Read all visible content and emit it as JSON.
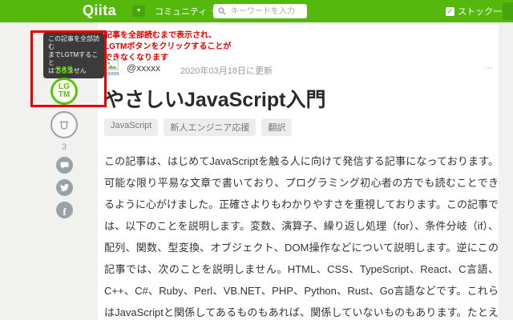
{
  "header": {
    "logo": "Qiita",
    "logo_caret": "▼",
    "community": "コミュニティ",
    "community_caret": "▼",
    "search_placeholder": "キーワードを入力",
    "stock_check": "✓",
    "stock_list": "ストック一覧"
  },
  "colors": {
    "brand_green": "#55b90d",
    "lgtm_green": "#55c500",
    "annotation_red": "#e60000",
    "icon_gray": "#9aa2a8"
  },
  "annotation": {
    "tooltip_lines": [
      "この記事を全部読む",
      "までLGTMすること",
      "はできません"
    ],
    "note_lines": [
      "記事を全部読むまで表示され、",
      "LGTMボタンをクリックすることが",
      "できなくなります"
    ]
  },
  "sidebar": {
    "lgtm_count": "365",
    "lgtm_line1": "LG",
    "lgtm_line2": "TM",
    "comment_count": "3",
    "facebook_glyph": "f",
    "icons": {
      "stock": "stock-icon",
      "comment": "comment-icon",
      "twitter": "twitter-icon",
      "facebook": "facebook-icon"
    }
  },
  "article": {
    "avatar_label": "xxxxx",
    "author": "@xxxxx",
    "updated": "2020年03月18日に更新",
    "more_menu": "…",
    "title": "やさしいJavaScript入門",
    "tags": [
      "JavaScript",
      "新人エンジニア応援",
      "翻訳"
    ],
    "body": "この記事は、はじめてJavaScriptを触る人に向けて発信する記事になっております。可能な限り平易な文章で書いており、プログラミング初心者の方でも読むことできるように心がけました。正確さよりもわかりやすさを重視しております。この記事では、以下のことを説明します。変数、演算子、繰り返し処理（for）、条件分岐（if）、配列、関数、型変換、オブジェクト、DOM操作などについて説明します。逆にこの記事では、次のことを説明しません。HTML、CSS、TypeScript、React、C言語、C++、C#、Ruby、Perl、VB.NET、PHP、Python、Rust、Go言語などです。これらはJavaScriptと関係してあるものもあれば、関係していないものもあります。たとえばHTMLやCSSはフロントエンドにおいてJavaScriptといっしょに使われることはありますが、C言語やC++言語とはいっしょに使われることは少ないです。このように、プログラミング言語と言っても、いろいろあるんですね。HTMLとCSSはプログラミング言語ではないので、厳密には違うんですけど。まあ、ともあれ、早速学んでいきましょう。ぐだぐだと書かれた文章を読むより、一行でもコードを書いたほうがいいですし、あなたもコードを書きたくてウズウズしていますよね？その意気です！20年前、私が初めてプログラミングに出会ったのは学生の頃ですが、そのときに初めてHelloWorldをしたときの感動をよく覚えています。興奮のあまり、つ"
  }
}
